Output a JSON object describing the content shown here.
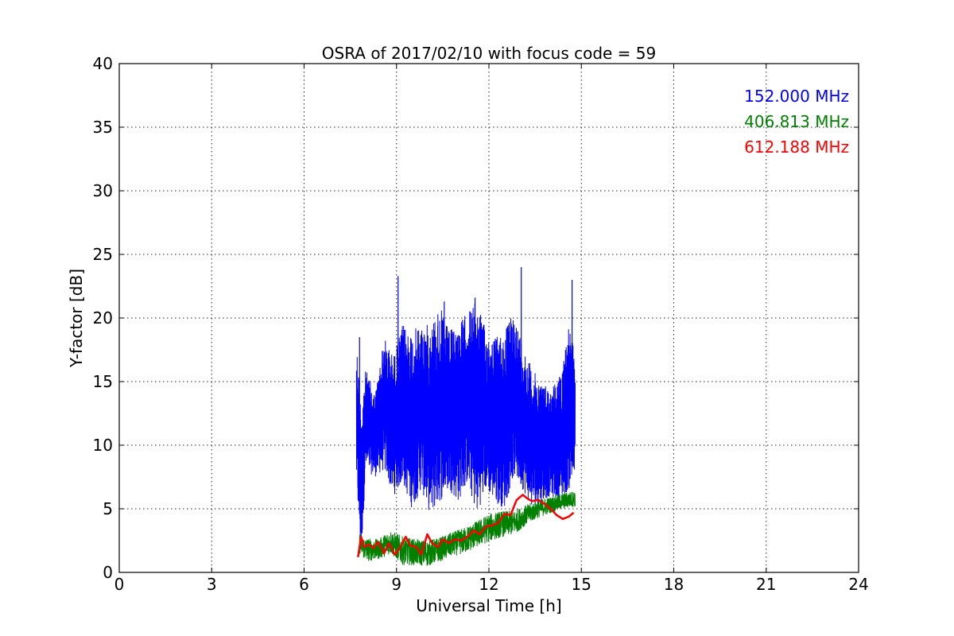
{
  "chart_data": {
    "type": "line",
    "title": "OSRA of 2017/02/10 with focus code = 59",
    "xlabel": "Universal Time [h]",
    "ylabel": "Y-factor [dB]",
    "xlim": [
      0,
      24
    ],
    "ylim": [
      0,
      40
    ],
    "xticks": [
      0,
      3,
      6,
      9,
      12,
      15,
      18,
      21,
      24
    ],
    "yticks": [
      0,
      5,
      10,
      15,
      20,
      25,
      30,
      35,
      40
    ],
    "grid": true,
    "legend_position": "top-right",
    "series": [
      {
        "name": "152.000 MHz",
        "color": "#0000ff",
        "style": "noisy",
        "x_range": [
          7.7,
          14.8
        ],
        "envelope": {
          "x": [
            7.7,
            7.85,
            8.0,
            8.3,
            8.6,
            8.9,
            9.2,
            9.5,
            9.8,
            10.1,
            10.4,
            10.7,
            11.0,
            11.3,
            11.6,
            11.9,
            12.2,
            12.5,
            12.8,
            13.1,
            13.4,
            13.7,
            14.0,
            14.3,
            14.6,
            14.8
          ],
          "upper": [
            18.5,
            13.0,
            16.0,
            14.0,
            18.5,
            17.0,
            19.5,
            19.0,
            19.5,
            19.5,
            21.0,
            19.0,
            19.5,
            20.5,
            21.5,
            19.0,
            18.5,
            19.0,
            20.5,
            18.0,
            16.0,
            15.0,
            14.5,
            15.5,
            19.5,
            17.0
          ],
          "lower": [
            7.0,
            1.0,
            8.0,
            7.5,
            8.0,
            6.0,
            7.0,
            5.0,
            6.5,
            4.5,
            5.5,
            6.5,
            5.5,
            7.0,
            4.5,
            6.5,
            5.5,
            5.0,
            7.5,
            6.5,
            5.0,
            5.5,
            6.0,
            5.5,
            6.5,
            7.5
          ]
        },
        "spikes": [
          [
            7.8,
            18.5
          ],
          [
            9.05,
            23.3
          ],
          [
            10.55,
            21.3
          ],
          [
            11.55,
            21.6
          ],
          [
            13.05,
            24.0
          ],
          [
            14.7,
            23.0
          ]
        ]
      },
      {
        "name": "406.813 MHz",
        "color": "#008000",
        "style": "band",
        "x": [
          7.8,
          8.0,
          8.4,
          8.8,
          9.2,
          9.6,
          10.0,
          10.4,
          10.8,
          11.2,
          11.6,
          12.0,
          12.4,
          12.8,
          13.2,
          13.6,
          14.0,
          14.4,
          14.8
        ],
        "values": [
          2.3,
          1.8,
          1.8,
          2.4,
          1.7,
          1.6,
          1.5,
          1.8,
          2.2,
          2.5,
          3.0,
          3.5,
          3.8,
          3.9,
          4.5,
          5.0,
          5.3,
          5.6,
          5.8
        ],
        "noise": [
          1.0,
          1.2,
          1.0,
          1.2,
          1.4,
          1.3,
          1.3,
          1.2,
          1.2,
          1.3,
          1.3,
          1.4,
          1.3,
          1.2,
          1.0,
          0.9,
          0.8,
          0.8,
          0.8
        ]
      },
      {
        "name": "612.188 MHz",
        "color": "#ff0000",
        "style": "line",
        "x": [
          7.75,
          7.85,
          7.95,
          8.1,
          8.25,
          8.4,
          8.6,
          8.75,
          8.95,
          9.1,
          9.3,
          9.45,
          9.65,
          9.8,
          10.0,
          10.15,
          10.35,
          10.5,
          10.7,
          10.9,
          11.1,
          11.3,
          11.5,
          11.7,
          11.9,
          12.1,
          12.3,
          12.5,
          12.7,
          12.9,
          13.1,
          13.25,
          13.4,
          13.6,
          13.8,
          14.0,
          14.2,
          14.4,
          14.6,
          14.75
        ],
        "values": [
          1.2,
          2.8,
          2.0,
          2.2,
          1.9,
          2.4,
          1.5,
          2.3,
          1.4,
          1.9,
          2.8,
          2.1,
          2.0,
          1.4,
          3.0,
          2.3,
          2.0,
          2.6,
          2.3,
          2.6,
          2.5,
          2.8,
          3.3,
          3.0,
          3.6,
          3.7,
          3.9,
          4.6,
          4.5,
          5.7,
          6.1,
          5.8,
          5.6,
          5.7,
          5.4,
          5.0,
          4.5,
          4.2,
          4.4,
          4.7
        ]
      }
    ]
  }
}
